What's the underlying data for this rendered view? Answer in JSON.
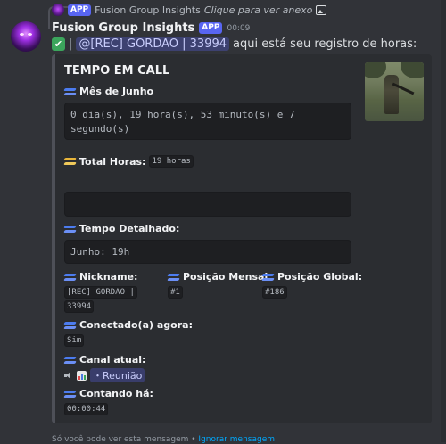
{
  "reply": {
    "app_tag": "APP",
    "author": "Fusion Group Insights",
    "text": "Clique para ver anexo",
    "image_icon": "image-icon"
  },
  "message": {
    "username": "Fusion Group Insights",
    "app_tag": "APP",
    "timestamp": "00:09",
    "check_icon": "✔",
    "separator": "|",
    "mention": "@[REC] GORDAO | 33994",
    "text": "aqui está seu registro de horas:"
  },
  "embed": {
    "title": "TEMPO EM CALL",
    "month_label": "Mês de Junho",
    "month_value": "0 dia(s), 19 hora(s), 53 minuto(s) e 7 segundo(s)",
    "total_label": "Total Horas:",
    "total_value": "19 horas",
    "empty_value": "",
    "detail_label": "Tempo Detalhado:",
    "detail_value": "Junho: 19h",
    "nickname_label": "Nickname:",
    "nickname_value": "[REC] GORDAO | 33994",
    "monthly_pos_label": "Posição Mensal:",
    "monthly_pos_value": "#1",
    "global_pos_label": "Posição Global:",
    "global_pos_value": "#186",
    "connected_label": "Conectado(a) agora:",
    "connected_value": "Sim",
    "channel_label": "Canal atual:",
    "channel_value": "・Reunião",
    "counting_label": "Contando há:",
    "counting_value": "00:00:44"
  },
  "footer": {
    "text": "Só você pode ver esta mensagem •",
    "link": "Ignorar mensagem"
  },
  "colors": {
    "background": "#313338",
    "embed_background": "#2b2d31",
    "app_tag": "#5865f2",
    "mention_text": "#c9cdfb"
  }
}
